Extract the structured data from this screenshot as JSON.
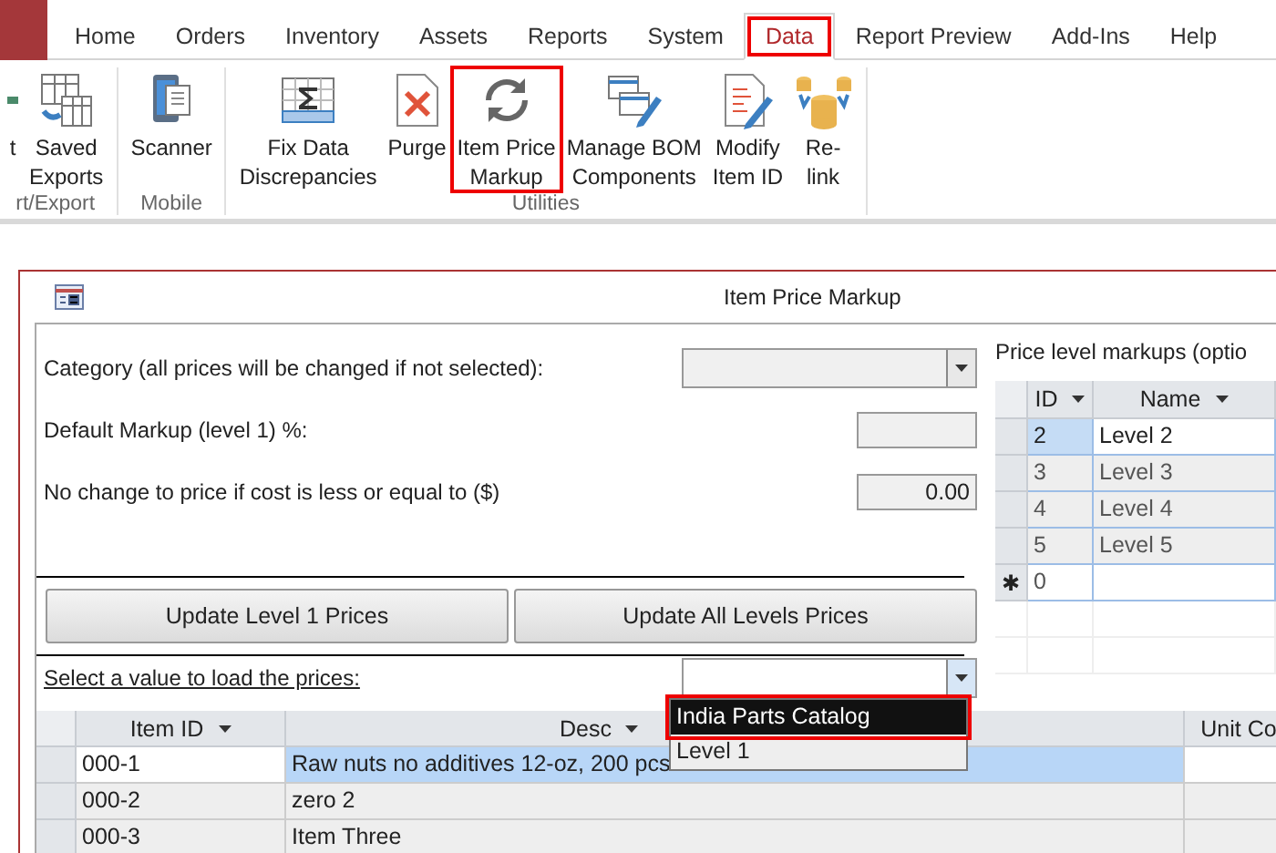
{
  "ribbon_tabs": [
    {
      "kind": "file",
      "selected": false,
      "highlighted": false
    },
    {
      "label": "Home",
      "kind": "tab",
      "selected": false,
      "highlighted": false
    },
    {
      "label": "Orders",
      "kind": "tab",
      "selected": false,
      "highlighted": false
    },
    {
      "label": "Inventory",
      "kind": "tab",
      "selected": false,
      "highlighted": false
    },
    {
      "label": "Assets",
      "kind": "tab",
      "selected": false,
      "highlighted": false
    },
    {
      "label": "Reports",
      "kind": "tab",
      "selected": false,
      "highlighted": false
    },
    {
      "label": "System",
      "kind": "tab",
      "selected": false,
      "highlighted": false
    },
    {
      "label": "Data",
      "kind": "tab",
      "selected": true,
      "highlighted": true
    },
    {
      "label": "Report Preview",
      "kind": "tab",
      "selected": false,
      "highlighted": false
    },
    {
      "label": "Add-Ins",
      "kind": "tab",
      "selected": false,
      "highlighted": false
    },
    {
      "label": "Help",
      "kind": "tab",
      "selected": false,
      "highlighted": false
    }
  ],
  "ribbon_groups": [
    {
      "label": "rt/Export",
      "buttons": [
        {
          "lines": [
            "t"
          ],
          "highlighted": false
        },
        {
          "lines": [
            "Saved",
            "Exports"
          ],
          "highlighted": false
        }
      ]
    },
    {
      "label": "Mobile",
      "buttons": [
        {
          "lines": [
            "Scanner"
          ],
          "highlighted": false
        }
      ]
    },
    {
      "label": "Utilities",
      "buttons": [
        {
          "lines": [
            "Fix Data",
            "Discrepancies"
          ],
          "highlighted": false
        },
        {
          "lines": [
            "Purge"
          ],
          "highlighted": false
        },
        {
          "lines": [
            "Item Price",
            "Markup"
          ],
          "highlighted": true
        },
        {
          "lines": [
            "Manage BOM",
            "Components"
          ],
          "highlighted": false
        },
        {
          "lines": [
            "Modify",
            "Item ID"
          ],
          "highlighted": false
        },
        {
          "lines": [
            "Re-",
            "link"
          ],
          "highlighted": false
        }
      ]
    }
  ],
  "form": {
    "title": "Item Price Markup",
    "category": {
      "label": "Category (all prices will be changed if not selected):"
    },
    "default_markup": {
      "label": "Default Markup (level 1) %:"
    },
    "no_change": {
      "label": "No change to price if cost is less or equal to ($)",
      "value": "0.00"
    },
    "buttons": [
      "Update Level 1 Prices",
      "Update All Levels Prices"
    ],
    "load_prices": {
      "label": "Select a value to load the prices:",
      "options": [
        {
          "label": "India Parts Catalog",
          "selected": true,
          "highlighted": true
        },
        {
          "label": "Level 1",
          "selected": false,
          "highlighted": false
        }
      ]
    },
    "price_levels": {
      "label": "Price level markups (optio",
      "columns": [
        "ID",
        "Name"
      ],
      "rows": [
        {
          "id": "2",
          "name": "Level 2",
          "selected": true,
          "kind": "row"
        },
        {
          "id": "3",
          "name": "Level 3",
          "selected": false,
          "kind": "row"
        },
        {
          "id": "4",
          "name": "Level 4",
          "selected": false,
          "kind": "row"
        },
        {
          "id": "5",
          "name": "Level 5",
          "selected": false,
          "kind": "row"
        },
        {
          "marker": "✱",
          "id": "0",
          "selected": false,
          "kind": "new"
        }
      ]
    },
    "items": {
      "columns": [
        "Item ID",
        "Desc",
        "Unit Co"
      ],
      "rows": [
        {
          "item_id": "000-1",
          "description": "Raw nuts no additives 12-oz, 200 pcs",
          "selected": true
        },
        {
          "item_id": "000-2",
          "description": "zero 2",
          "selected": false
        },
        {
          "item_id": "000-3",
          "description": "Item Three",
          "selected": false
        }
      ]
    }
  }
}
